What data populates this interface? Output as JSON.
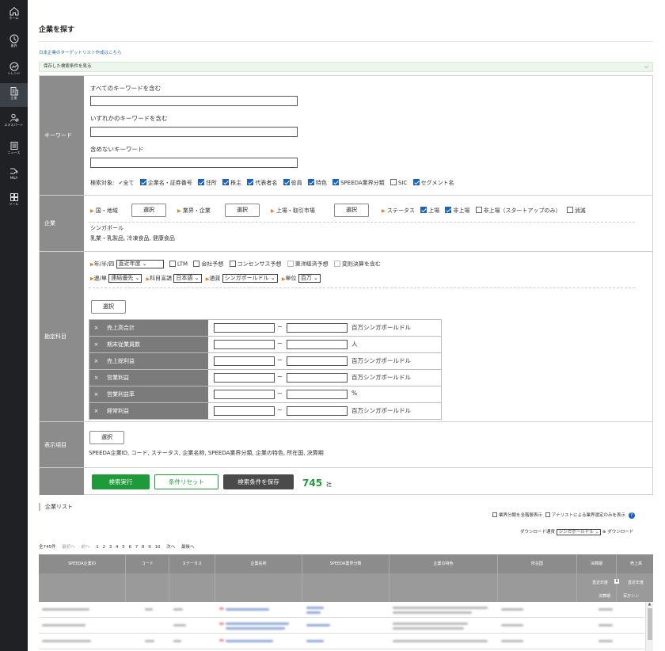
{
  "sidebar": {
    "items": [
      {
        "label": "ホーム",
        "icon": "home-icon"
      },
      {
        "label": "業界",
        "icon": "industry-icon"
      },
      {
        "label": "トレンド",
        "icon": "trend-icon"
      },
      {
        "label": "企業",
        "icon": "company-icon"
      },
      {
        "label": "エキスパート",
        "icon": "expert-icon"
      },
      {
        "label": "ニュース",
        "icon": "news-icon"
      },
      {
        "label": "M&A",
        "icon": "ma-icon"
      },
      {
        "label": "ツール",
        "icon": "tools-icon"
      }
    ],
    "active_index": 3
  },
  "page": {
    "title": "企業を探す",
    "target_list_link": "日本企業のターゲットリスト作成はこちら",
    "saved_conditions": "保存した検索条件を見る"
  },
  "keyword": {
    "header": "キーワード",
    "all_label": "すべてのキーワードを含む",
    "all_value": "",
    "any_label": "いずれかのキーワードを含む",
    "any_value": "",
    "none_label": "含めないキーワード",
    "none_value": "",
    "target_label": "検索対象:",
    "targets": [
      "全て",
      "企業名・証券番号",
      "住所",
      "株主",
      "代表者名",
      "役員",
      "特色",
      "SPEEDA業界分類",
      "SIC",
      "セグメント名"
    ]
  },
  "company": {
    "header": "企業",
    "country_label": "国・地域",
    "industry_label": "業界・企業",
    "market_label": "上場・取引市場",
    "select_label": "選択",
    "status_label": "ステータス",
    "status_options": [
      "上場",
      "非上場",
      "非上場（スタートアップのみ）",
      "消滅"
    ],
    "selected_country": "シンガポール",
    "selected_industry": "乳業・乳製品, 冷凍食品, 健康食品"
  },
  "accounts": {
    "header": "勘定科目",
    "period_label": "年/半/四",
    "period_value": "直近年度",
    "opts1": [
      "LTM",
      "会社予想",
      "コンセンサス予想",
      "東洋経済予想",
      "変則決算を含む"
    ],
    "consolidation_label": "連/単",
    "consolidation_value": "連結優先",
    "lang_label": "科目言語",
    "lang_value": "日本語",
    "currency_label": "通貨",
    "currency_value": "シンガポールドル",
    "unit_label": "単位",
    "unit_value": "百万",
    "select_label": "選択",
    "tilde": "~",
    "remove": "×",
    "rows": [
      {
        "name": "売上高合計",
        "unit": "百万シンガポールドル"
      },
      {
        "name": "期末従業員数",
        "unit": "人"
      },
      {
        "name": "売上総利益",
        "unit": "百万シンガポールドル"
      },
      {
        "name": "営業利益",
        "unit": "百万シンガポールドル"
      },
      {
        "name": "営業利益率",
        "unit": "%"
      },
      {
        "name": "経常利益",
        "unit": "百万シンガポールドル"
      }
    ]
  },
  "display": {
    "header": "表示項目",
    "select_label": "選択",
    "items": "SPEEDA企業ID, コード, ステータス, 企業名称, SPEEDA業界分類, 企業の特色, 所在国, 決算期"
  },
  "actions": {
    "search": "検索実行",
    "reset": "条件リセット",
    "save": "検索条件を保存",
    "count": "745",
    "count_unit": "社"
  },
  "list": {
    "title": "企業リスト",
    "opt_all_industry": "業界分類を全階層表示",
    "opt_analyst": "アナリストによる業界選定のみを表示",
    "download_currency_label": "ダウンロード通貨",
    "download_currency": "シンガポールドル",
    "download": "ダウンロード",
    "total": "全745件",
    "first": "最初へ",
    "prev": "前へ",
    "pages": [
      "1",
      "2",
      "3",
      "4",
      "5",
      "6",
      "7",
      "8",
      "9",
      "10"
    ],
    "next": "次へ",
    "last": "最後へ",
    "columns": [
      "SPEEDA企業ID",
      "コード",
      "ステータス",
      "企業名称",
      "SPEEDA業界分類",
      "企業の特色",
      "所在国",
      "決算期",
      "売上高"
    ],
    "sub_recent": "直近年度",
    "sub_period": "決算期",
    "sub_currency": "百万シン"
  }
}
